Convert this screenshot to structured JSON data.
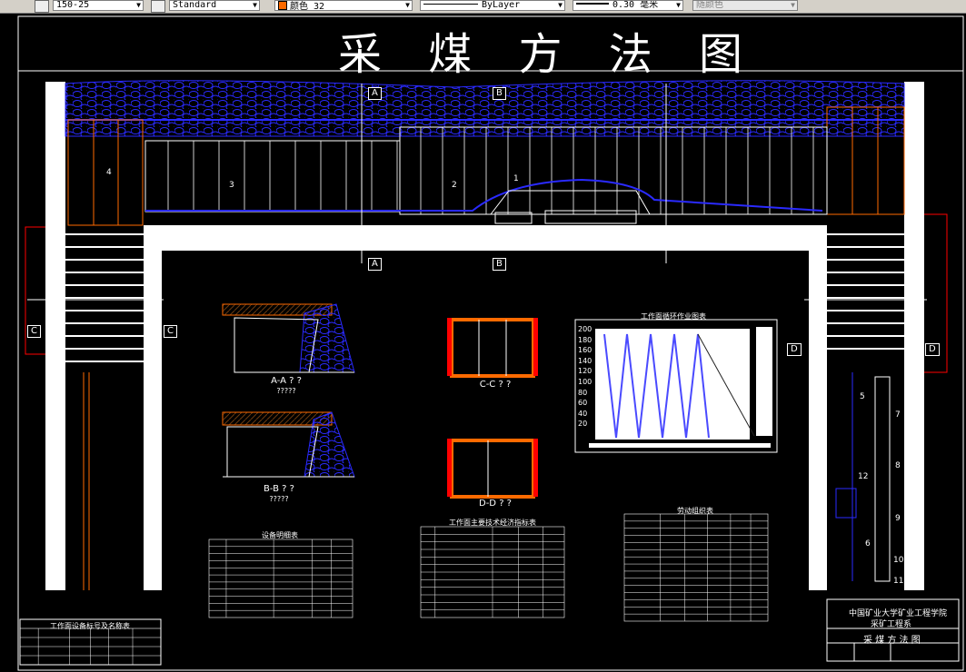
{
  "toolbar": {
    "dimstyle_value": "150-25",
    "textstyle_value": "Standard",
    "color_value": "颜色 32",
    "linetype_value": "ByLayer",
    "lineweight_value": "0.30 毫米",
    "plotstyle_value": "随颜色"
  },
  "drawing": {
    "title": "采 煤 方 法 图",
    "section_marks": {
      "a": "A",
      "b": "B",
      "c": "C",
      "d": "D"
    },
    "callouts": [
      "1",
      "2",
      "3",
      "4",
      "5",
      "6",
      "7",
      "8",
      "9",
      "10",
      "11",
      "12"
    ],
    "view_captions": {
      "aa": "A-A ? ?",
      "aa_sub": "?????",
      "bb": "B-B ? ?",
      "bb_sub": "?????",
      "cc": "C-C ? ?",
      "dd": "D-D ? ?"
    },
    "chart_title": "工作面循环作业图表",
    "chart_y_ticks": [
      "200",
      "180",
      "160",
      "140",
      "120",
      "100",
      "80",
      "60",
      "40",
      "20"
    ],
    "table_titles": {
      "equipment": "设备明细表",
      "tech_econ": "工作面主要技术经济指标表",
      "labor": "劳动组织表",
      "legend": "工作面设备标号及名称表"
    },
    "title_block": {
      "org": "中国矿业大学矿业工程学院",
      "dept": "采矿工程系",
      "name": "采 煤 方 法 图"
    }
  },
  "colors": {
    "background": "#000000",
    "coal_hatch": "#1a1aff",
    "support": "#ff6a00",
    "outline": "#ffffff",
    "red_line": "#ff0000",
    "chart_line": "#4a4aff"
  }
}
